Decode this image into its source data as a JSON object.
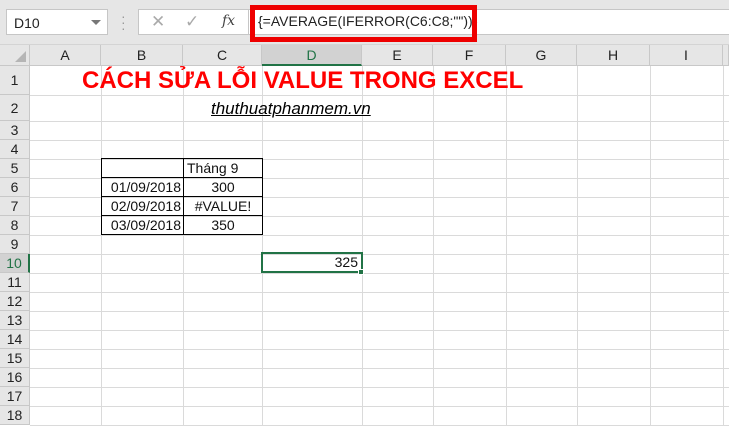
{
  "name_box": "D10",
  "formula_bar": {
    "cancel_icon": "✕",
    "enter_icon": "✓",
    "fx_label": "fx",
    "formula": "{=AVERAGE(IFERROR(C6:C8;\"\"))}"
  },
  "columns": [
    "A",
    "B",
    "C",
    "D",
    "E",
    "F",
    "G",
    "H",
    "I"
  ],
  "rows": [
    "1",
    "2",
    "3",
    "4",
    "5",
    "6",
    "7",
    "8",
    "9",
    "10",
    "11",
    "12",
    "13",
    "14",
    "15",
    "16",
    "17",
    "18"
  ],
  "cells": {
    "title": "CÁCH SỬA LỖI VALUE TRONG EXCEL",
    "subtitle": "thuthuatphanmem.vn",
    "header_c5": "Tháng 9",
    "b6": "01/09/2018",
    "c6": "300",
    "b7": "02/09/2018",
    "c7": "#VALUE!",
    "b8": "03/09/2018",
    "c8": "350",
    "d10": "325"
  },
  "colors": {
    "accent": "#217346",
    "highlight": "#ee0000",
    "title": "#ff0000"
  }
}
